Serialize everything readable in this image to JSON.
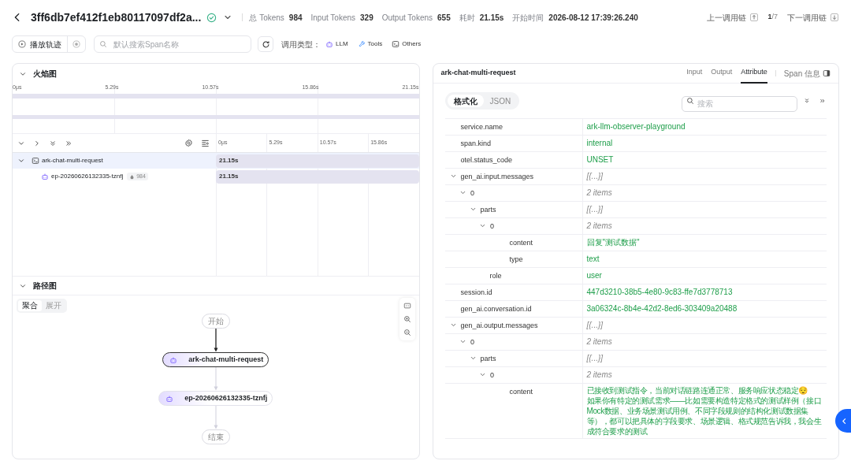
{
  "header": {
    "title": "3ff6db7ef412f1eb80117097df2a...",
    "stats": [
      {
        "label": "总 Tokens",
        "value": "984"
      },
      {
        "label": "Input Tokens",
        "value": "329"
      },
      {
        "label": "Output Tokens",
        "value": "655"
      },
      {
        "label": "耗时",
        "value": "21.15s"
      },
      {
        "label": "开始时间",
        "value": "2026-08-12 17:39:26.240"
      }
    ],
    "prev": "上一调用链",
    "position": "**1**/7",
    "next": "下一调用链"
  },
  "toolbar": {
    "play": "播放轨迹",
    "search_placeholder": "默认搜索Span名称",
    "type_label": "调用类型：",
    "types": [
      {
        "kind": "llm",
        "label": "LLM"
      },
      {
        "kind": "tool",
        "label": "Tools"
      },
      {
        "kind": "other",
        "label": "Others"
      }
    ]
  },
  "flame": {
    "title": "火焰图",
    "overview_ticks": [
      "0μs",
      "5.29s",
      "10.57s",
      "15.86s",
      "21.15s"
    ],
    "timeline_ticks": [
      "0μs",
      "5.29s",
      "10.57s",
      "15.86s"
    ],
    "spans": [
      {
        "kind": "terminal",
        "name": "ark-chat-multi-request",
        "duration": "21.15s",
        "selected": true,
        "expanded": true,
        "children": [
          {
            "kind": "llm",
            "name": "ep-20260626132335-tznfj",
            "tokens": "984",
            "duration": "21.15s",
            "selected": false
          }
        ]
      }
    ]
  },
  "path": {
    "title": "路径图",
    "modes": [
      {
        "label": "聚合",
        "selected": true
      },
      {
        "label": "展开",
        "selected": false
      }
    ],
    "nodes": [
      {
        "kind": "terminal",
        "label": "开始"
      },
      {
        "kind": "span",
        "label": "ark-chat-multi-request",
        "selected": true
      },
      {
        "kind": "span",
        "label": "ep-20260626132335-tznfj",
        "selected": false
      },
      {
        "kind": "terminal",
        "label": "结束"
      }
    ]
  },
  "detail": {
    "title": "ark-chat-multi-request",
    "tabs": [
      {
        "label": "Input",
        "selected": false
      },
      {
        "label": "Output",
        "selected": false
      },
      {
        "label": "Attribute",
        "selected": true
      }
    ],
    "span_info": "Span 信息",
    "views": [
      {
        "label": "格式化",
        "selected": true
      },
      {
        "label": "JSON",
        "selected": false
      }
    ],
    "search_placeholder": "搜索",
    "attributes": [
      {
        "key": "service.name",
        "kind": "string",
        "value": "ark-llm-observer-playground"
      },
      {
        "key": "span.kind",
        "kind": "string",
        "value": "internal"
      },
      {
        "key": "otel.status_code",
        "kind": "string",
        "value": "UNSET"
      },
      {
        "key": "gen_ai.input.messages",
        "kind": "summary",
        "value": "[{...}]",
        "expanded": true,
        "children": [
          {
            "key": "0",
            "kind": "summary",
            "value": "2 items",
            "expanded": true,
            "children": [
              {
                "key": "parts",
                "kind": "summary",
                "value": "[{...}]",
                "expanded": true,
                "children": [
                  {
                    "key": "0",
                    "kind": "summary",
                    "value": "2 items",
                    "expanded": true,
                    "children": [
                      {
                        "key": "content",
                        "kind": "string",
                        "value": "回复\"测试数据\""
                      },
                      {
                        "key": "type",
                        "kind": "string",
                        "value": "text"
                      }
                    ]
                  }
                ]
              },
              {
                "key": "role",
                "kind": "string",
                "value": "user"
              }
            ]
          }
        ]
      },
      {
        "key": "session.id",
        "kind": "string",
        "value": "447d3210-38b5-4e80-9c83-ffe7d3778713"
      },
      {
        "key": "gen_ai.conversation.id",
        "kind": "string",
        "value": "3a06324c-8b4e-42d2-8ed6-303409a20488"
      },
      {
        "key": "gen_ai.output.messages",
        "kind": "summary",
        "value": "[{...}]",
        "expanded": true,
        "children": [
          {
            "key": "0",
            "kind": "summary",
            "value": "2 items",
            "expanded": true,
            "children": [
              {
                "key": "parts",
                "kind": "summary",
                "value": "[{...}]",
                "expanded": true,
                "children": [
                  {
                    "key": "0",
                    "kind": "summary",
                    "value": "2 items",
                    "expanded": true,
                    "children": [
                      {
                        "key": "content",
                        "kind": "string",
                        "value": "已接收到测试指令，当前对话链路连通正常、服务响应状态稳定😌\n如果你有特定的测试需求——比如需要构造特定格式的测试样例（接口Mock数据、业务场景测试用例、不同字段规则的结构化测试数据集等），都可以把具体的字段要求、场景逻辑、格式规范告诉我，我会生成符合要求的测试"
                      }
                    ]
                  }
                ]
              }
            ]
          }
        ]
      }
    ]
  }
}
